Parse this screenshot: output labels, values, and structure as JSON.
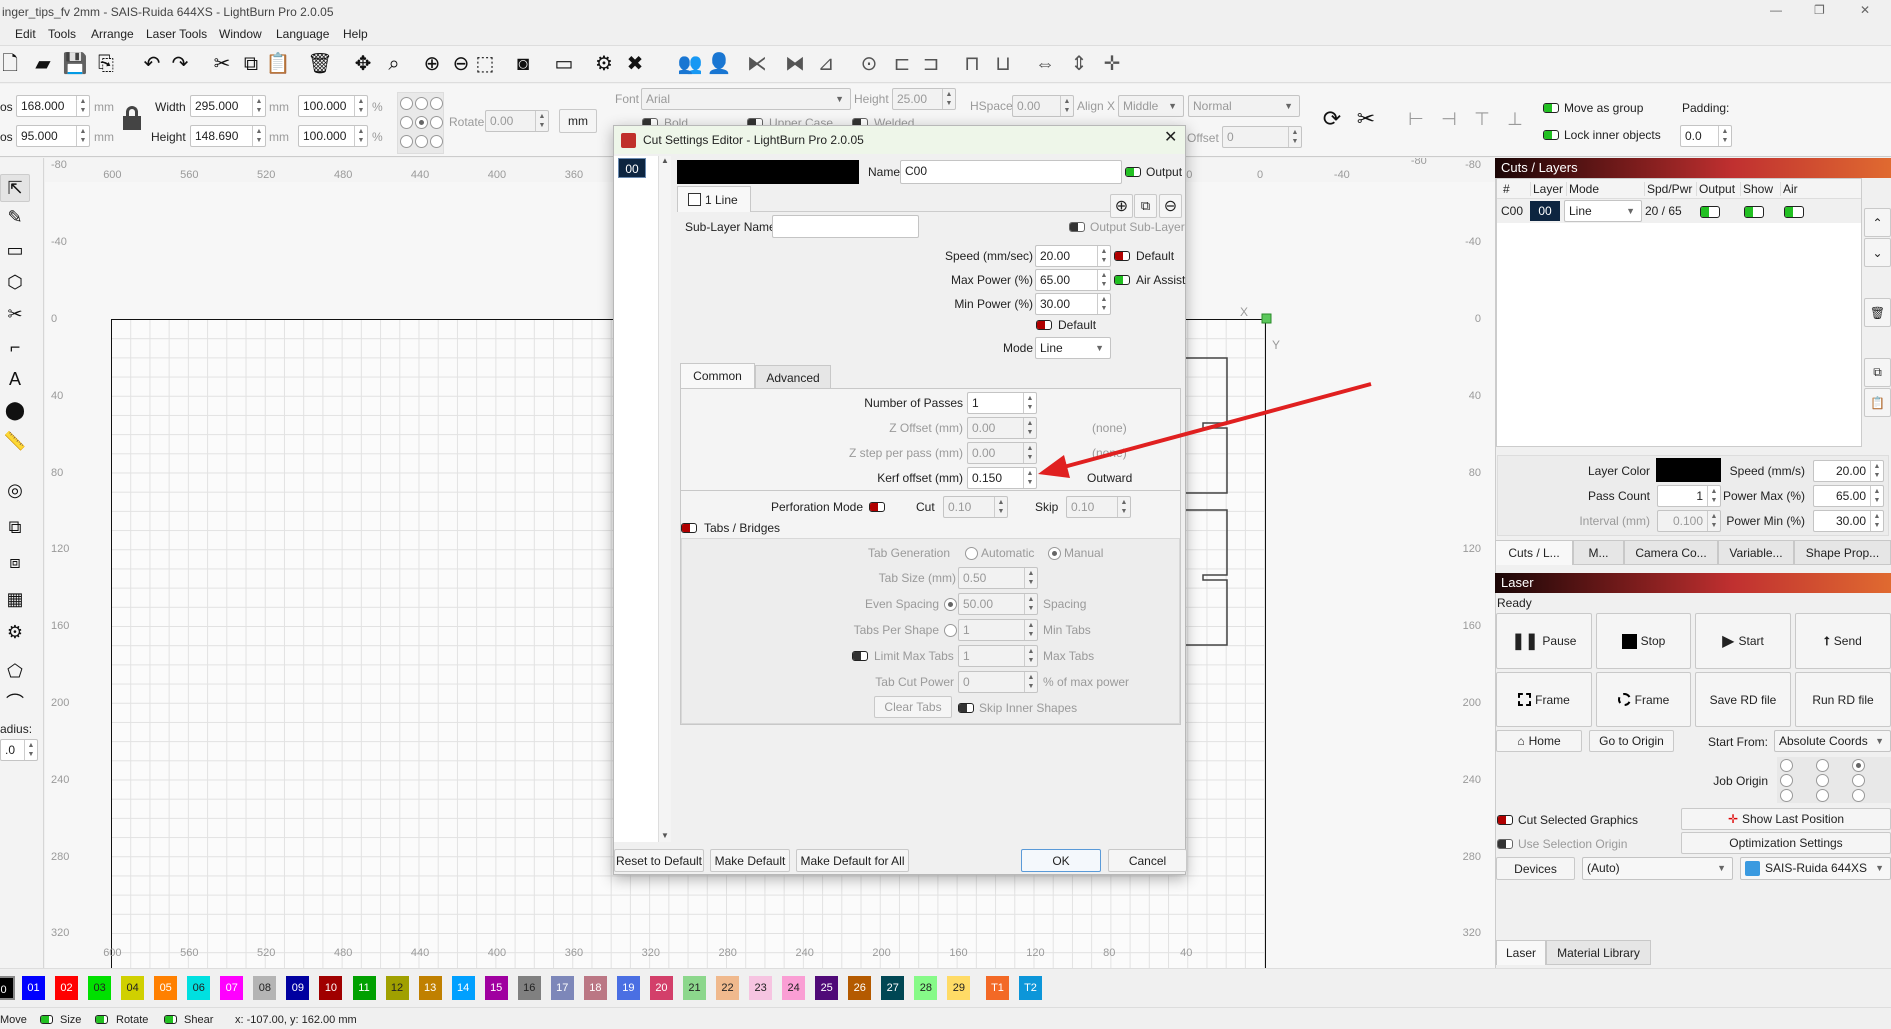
{
  "window": {
    "title": "inger_tips_fv 2mm - SAIS-Ruida 644XS - LightBurn Pro 2.0.05",
    "minimize": "—",
    "restore": "❐",
    "close": "✕"
  },
  "menu": [
    "Edit",
    "Tools",
    "Arrange",
    "Laser Tools",
    "Window",
    "Language",
    "Help"
  ],
  "toolbar": [
    {
      "icon": "new-file-icon",
      "glyph": "🗋"
    },
    {
      "icon": "open-folder-icon",
      "glyph": "▰"
    },
    {
      "icon": "save-icon",
      "glyph": "💾"
    },
    {
      "icon": "import-icon",
      "glyph": "⎘"
    },
    {
      "icon": "undo-icon",
      "glyph": "↶"
    },
    {
      "icon": "redo-icon",
      "glyph": "↷"
    },
    {
      "icon": "cut-icon",
      "glyph": "✂"
    },
    {
      "icon": "copy-icon",
      "glyph": "⧉"
    },
    {
      "icon": "paste-icon",
      "glyph": "📋"
    },
    {
      "icon": "delete-icon",
      "glyph": "🗑"
    },
    {
      "icon": "move-icon",
      "glyph": "✥"
    },
    {
      "icon": "zoom-page-icon",
      "glyph": "⌕"
    },
    {
      "icon": "zoom-in-icon",
      "glyph": "⊕"
    },
    {
      "icon": "zoom-out-icon",
      "glyph": "⊖"
    },
    {
      "icon": "zoom-selection-icon",
      "glyph": "⬚"
    },
    {
      "icon": "camera-icon",
      "glyph": "◙"
    },
    {
      "icon": "monitor-icon",
      "glyph": "▭"
    },
    {
      "icon": "settings-icon",
      "glyph": "⚙"
    },
    {
      "icon": "tools-icon",
      "glyph": "✖"
    },
    {
      "icon": "group-icon",
      "glyph": "👥"
    },
    {
      "icon": "ungroup-icon",
      "glyph": "👤"
    },
    {
      "icon": "mirror-horizontal-icon",
      "glyph": "⧔"
    },
    {
      "icon": "mirror-vertical-icon",
      "glyph": "⧓"
    },
    {
      "icon": "mirror-line-icon",
      "glyph": "⊿"
    },
    {
      "icon": "center-icon",
      "glyph": "⊙"
    },
    {
      "icon": "align-left-icon",
      "glyph": "⊏"
    },
    {
      "icon": "align-right-icon",
      "glyph": "⊐"
    },
    {
      "icon": "align-top-icon",
      "glyph": "⊓"
    },
    {
      "icon": "align-bottom-icon",
      "glyph": "⊔"
    },
    {
      "icon": "distribute-h-icon",
      "glyph": "⇔"
    },
    {
      "icon": "distribute-v-icon",
      "glyph": "⇕"
    },
    {
      "icon": "move-to-center-icon",
      "glyph": "✛"
    }
  ],
  "props": {
    "xpos_label": "os",
    "xpos": "168.000",
    "ypos_label": "os",
    "ypos": "95.000",
    "unit": "mm",
    "width_label": "Width",
    "width": "295.000",
    "height_label": "Height",
    "height": "148.690",
    "width_pct": "100.000",
    "height_pct": "100.000",
    "pct": "%",
    "rotate_label": "Rotate",
    "rotate": "0.00",
    "units_button": "mm",
    "font_label": "Font",
    "font": "Arial",
    "text_height_label": "Height",
    "text_height": "25.00",
    "hspace_label": "HSpace",
    "hspace": "0.00",
    "alignx_label": "Align X",
    "alignx": "Middle",
    "style": "Normal",
    "bold": "Bold",
    "upper": "Upper Case",
    "welded": "Welded",
    "offset_label": "Offset",
    "offset": "0",
    "move_group": "Move as group",
    "lock_inner": "Lock inner objects",
    "padding_label": "Padding:",
    "padding": "0.0"
  },
  "tools": [
    "select-tool-icon",
    "pen-tool-icon",
    "rectangle-tool-icon",
    "polygon-tool-icon",
    "trim-tool-icon",
    "frame-tool-icon",
    "text-tool-icon",
    "position-pin-icon",
    "measure-tool-icon",
    "offset-icon",
    "boolean-union-icon",
    "weld-icon",
    "grid-array-icon",
    "circular-array-icon",
    "edit-nodes-icon",
    "fillet-icon"
  ],
  "tool_glyphs": [
    "⇱",
    "✎",
    "▭",
    "⬡",
    "✂",
    "⌐",
    "A",
    "⬤",
    "📏",
    "◎",
    "⧉",
    "⧈",
    "▦",
    "⚙",
    "⬠",
    "⌒"
  ],
  "radius": {
    "label": "adius:",
    "value": ".0"
  },
  "rulers": {
    "top": [
      600,
      560,
      520,
      480,
      440,
      400,
      360,
      320,
      280,
      240,
      200,
      160,
      120,
      80,
      40,
      0,
      -40,
      -80
    ],
    "bottom": [
      600,
      560,
      520,
      480,
      440,
      400,
      360,
      320,
      280,
      240,
      200,
      160,
      120,
      80,
      40
    ],
    "left": [
      -80,
      -40,
      0,
      40,
      80,
      120,
      160,
      200,
      240,
      280,
      320
    ],
    "axis_x": "X",
    "axis_y": "Y"
  },
  "dialog": {
    "title": "Cut Settings Editor - LightBurn Pro 2.0.05",
    "layer_chip": "00",
    "name_label": "Name",
    "name": "C00",
    "output": "Output",
    "sublayer_tab": "1 Line",
    "sublayer_name_label": "Sub-Layer Name",
    "sublayer_name": "",
    "output_sublayer": "Output Sub-Layer",
    "speed_label": "Speed (mm/sec)",
    "speed": "20.00",
    "speed_default": "Default",
    "max_power_label": "Max Power (%)",
    "max_power": "65.00",
    "air_assist": "Air Assist",
    "min_power_label": "Min Power (%)",
    "min_power": "30.00",
    "power_default": "Default",
    "mode_label": "Mode",
    "mode": "Line",
    "tabs": [
      "Common",
      "Advanced"
    ],
    "passes_label": "Number of Passes",
    "passes": "1",
    "zoffset_label": "Z Offset (mm)",
    "zoffset": "0.00",
    "zoffset_note": "(none)",
    "zstep_label": "Z step per pass (mm)",
    "zstep": "0.00",
    "zstep_note": "(none)",
    "kerf_label": "Kerf offset (mm)",
    "kerf": "0.150",
    "kerf_note": "Outward",
    "perf_label": "Perforation Mode",
    "cut_label": "Cut",
    "cut": "0.10",
    "skip_label": "Skip",
    "skip": "0.10",
    "tabs_label": "Tabs / Bridges",
    "tabgen_label": "Tab Generation",
    "automatic": "Automatic",
    "manual": "Manual",
    "tabsize_label": "Tab Size (mm)",
    "tabsize": "0.50",
    "even_label": "Even Spacing",
    "even": "50.00",
    "spacing": "Spacing",
    "per_shape_label": "Tabs Per Shape",
    "per_shape": "1",
    "min_tabs": "Min Tabs",
    "limit_label": "Limit Max Tabs",
    "limit": "1",
    "max_tabs": "Max Tabs",
    "tabpower_label": "Tab Cut Power",
    "tabpower": "0",
    "tabpower_unit": "% of max power",
    "clear_tabs": "Clear Tabs",
    "skip_inner": "Skip Inner Shapes",
    "reset": "Reset to Default",
    "make_default": "Make Default",
    "make_default_all": "Make Default for All",
    "ok": "OK",
    "cancel": "Cancel"
  },
  "cuts": {
    "title": "Cuts / Layers",
    "columns": [
      "#",
      "Layer",
      "Mode",
      "Spd/Pwr",
      "Output",
      "Show",
      "Air"
    ],
    "rows": [
      {
        "id": "C00",
        "layer": "00",
        "mode": "Line",
        "spdpwr": "20 / 65",
        "output": true,
        "show": true,
        "air": true
      }
    ],
    "layer_color_label": "Layer Color",
    "speed_label": "Speed (mm/s)",
    "speed": "20.00",
    "pass_label": "Pass Count",
    "pass": "1",
    "pmax_label": "Power Max (%)",
    "pmax": "65.00",
    "interval_label": "Interval (mm)",
    "interval": "0.100",
    "pmin_label": "Power Min (%)",
    "pmin": "30.00",
    "tabs": [
      "Cuts / L...",
      "M...",
      "Camera Co...",
      "Variable...",
      "Shape Prop..."
    ]
  },
  "laser": {
    "title": "Laser",
    "status": "Ready",
    "pause": "Pause",
    "stop": "Stop",
    "start": "Start",
    "send": "Send",
    "frame": "Frame",
    "frame2": "Frame",
    "save_rd": "Save RD file",
    "run_rd": "Run RD file",
    "home": "Home",
    "origin": "Go to Origin",
    "start_from_label": "Start From:",
    "start_from": "Absolute Coords",
    "job_origin_label": "Job Origin",
    "cut_selected": "Cut Selected Graphics",
    "show_last": "Show Last Position",
    "use_sel_origin": "Use Selection Origin",
    "optimization": "Optimization Settings",
    "devices": "Devices",
    "port": "(Auto)",
    "device": "SAIS-Ruida 644XS",
    "tabs": [
      "Laser",
      "Material Library"
    ]
  },
  "palette": [
    {
      "l": "0",
      "c": "#000000"
    },
    {
      "l": "01",
      "c": "#0000ff"
    },
    {
      "l": "02",
      "c": "#ff0000"
    },
    {
      "l": "03",
      "c": "#00e000"
    },
    {
      "l": "04",
      "c": "#d0d000"
    },
    {
      "l": "05",
      "c": "#ff8000"
    },
    {
      "l": "06",
      "c": "#00e0e0"
    },
    {
      "l": "07",
      "c": "#ff00ff"
    },
    {
      "l": "08",
      "c": "#b4b4b4"
    },
    {
      "l": "09",
      "c": "#0000a0"
    },
    {
      "l": "10",
      "c": "#a00000"
    },
    {
      "l": "11",
      "c": "#00a000"
    },
    {
      "l": "12",
      "c": "#a0a000"
    },
    {
      "l": "13",
      "c": "#c08000"
    },
    {
      "l": "14",
      "c": "#00a0ff"
    },
    {
      "l": "15",
      "c": "#a000a0"
    },
    {
      "l": "16",
      "c": "#808080"
    },
    {
      "l": "17",
      "c": "#7d87b9"
    },
    {
      "l": "18",
      "c": "#bb7784"
    },
    {
      "l": "19",
      "c": "#4a6fe3"
    },
    {
      "l": "20",
      "c": "#d33f6a"
    },
    {
      "l": "21",
      "c": "#8cd78c"
    },
    {
      "l": "22",
      "c": "#f0b98d"
    },
    {
      "l": "23",
      "c": "#f6c4e1"
    },
    {
      "l": "24",
      "c": "#fa9ed4"
    },
    {
      "l": "25",
      "c": "#500a78"
    },
    {
      "l": "26",
      "c": "#b45a00"
    },
    {
      "l": "27",
      "c": "#004754"
    },
    {
      "l": "28",
      "c": "#86fa88"
    },
    {
      "l": "29",
      "c": "#ffdb66"
    },
    {
      "l": "T1",
      "c": "#f36926"
    },
    {
      "l": "T2",
      "c": "#0c96d9"
    }
  ],
  "status": {
    "move": "Move",
    "size": "Size",
    "rotate": "Rotate",
    "shear": "Shear",
    "coords": "x: -107.00, y: 162.00 mm"
  },
  "colors": {
    "accent_arrow": "#e02020",
    "layer_chip": "#0d2540",
    "dialog_title_bg": "#eef6e9"
  }
}
